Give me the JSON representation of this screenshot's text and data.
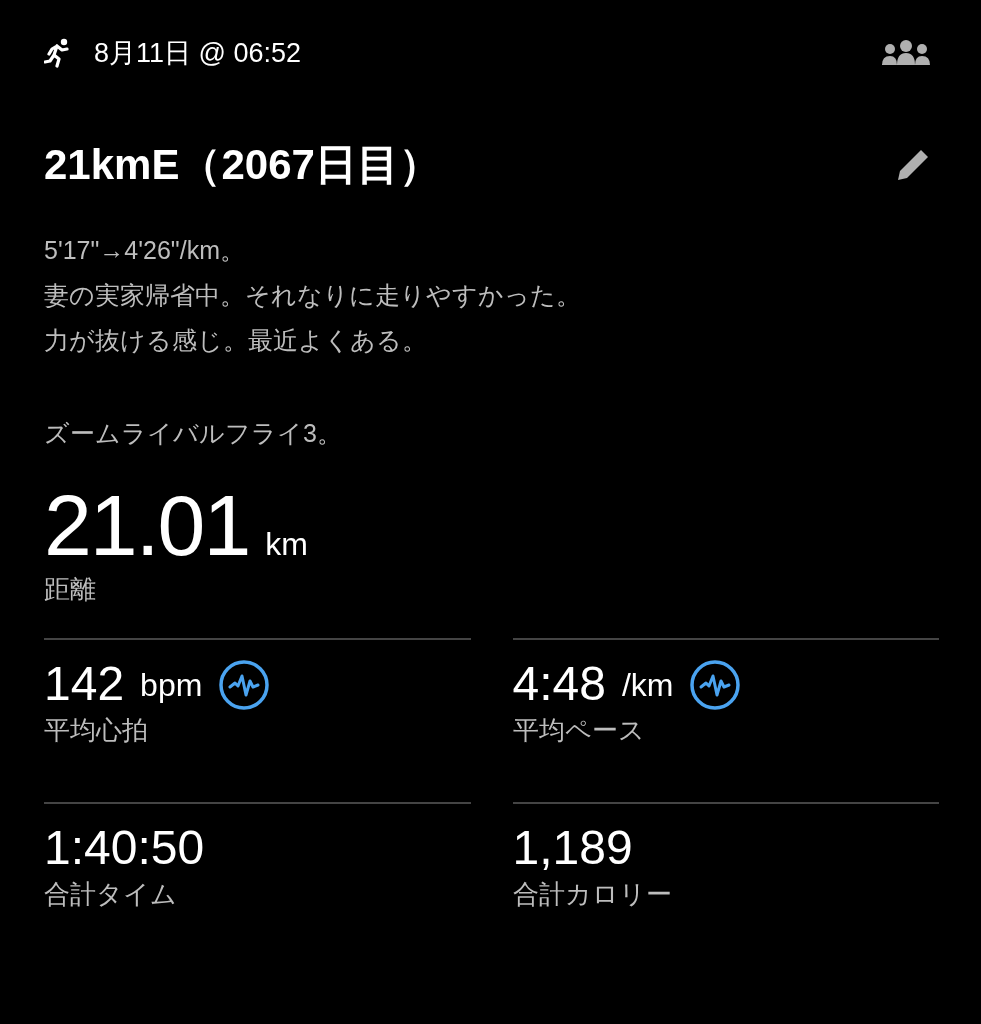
{
  "header": {
    "datetime": "8月11日 @ 06:52"
  },
  "title": "21kmE（2067日目）",
  "description": [
    [
      "5'17\"→4'26\"/km。",
      "妻の実家帰省中。それなりに走りやすかった。",
      "力が抜ける感じ。最近よくある。"
    ],
    [
      "ズームライバルフライ3。"
    ]
  ],
  "distance": {
    "value": "21.01",
    "unit": "km",
    "label": "距離"
  },
  "stats": [
    {
      "value": "142",
      "unit": "bpm",
      "label": "平均心拍",
      "detail_icon": true
    },
    {
      "value": "4:48",
      "unit": "/km",
      "label": "平均ペース",
      "detail_icon": true
    },
    {
      "value": "1:40:50",
      "label": "合計タイム",
      "detail_icon": false
    },
    {
      "value": "1,189",
      "label": "合計カロリー",
      "detail_icon": false
    }
  ]
}
